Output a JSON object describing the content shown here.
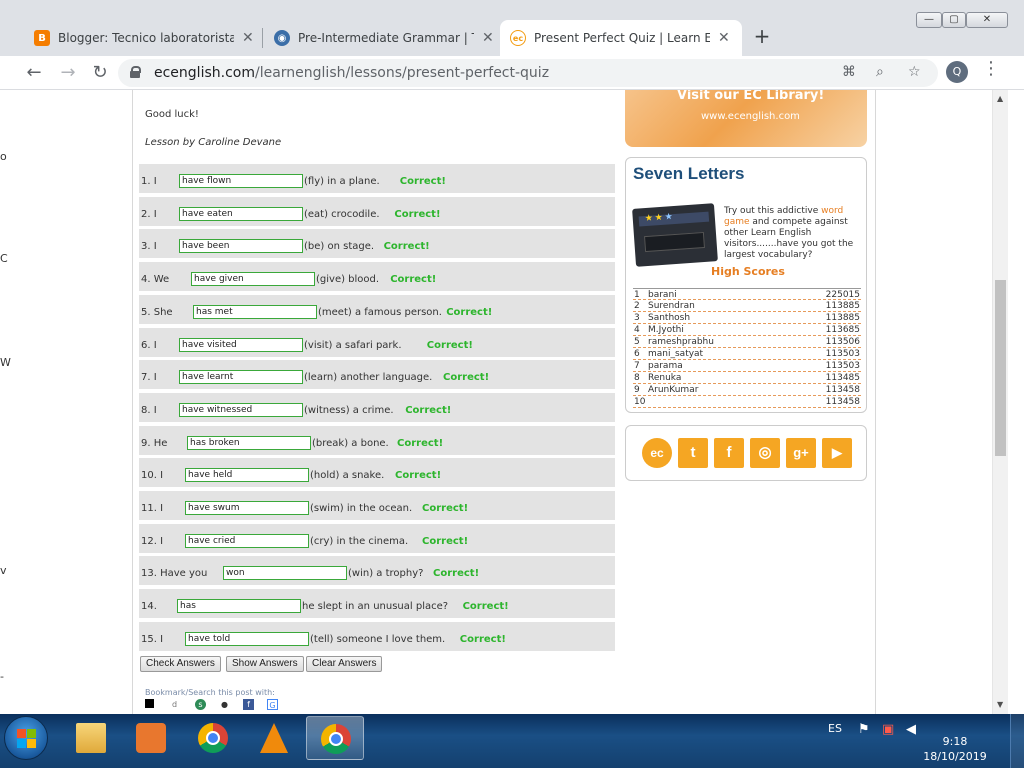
{
  "browser": {
    "tabs": [
      {
        "title": "Blogger: Tecnico laboratorista qu",
        "icon": "blogger-icon",
        "color": "#f57d00"
      },
      {
        "title": "Pre-Intermediate Grammar | The",
        "icon": "globe-icon",
        "color": "#3b6ea8"
      },
      {
        "title": "Present Perfect Quiz | Learn Engli",
        "icon": "ec-icon",
        "color": "#f39c12"
      }
    ],
    "close_glyph": "✕",
    "new_tab_glyph": "+",
    "url_host": "ecenglish.com",
    "url_path": "/learnenglish/lessons/present-perfect-quiz",
    "profile_initial": "Q",
    "menu_glyph": "⋮",
    "win_min": "—",
    "win_max": "▢",
    "win_close": "✕"
  },
  "page": {
    "left_edge_letters": [
      "o",
      "C",
      "W",
      "v",
      "-"
    ],
    "intro": {
      "good_luck": "Good luck!",
      "author": "Lesson by Caroline Devane"
    },
    "questions": [
      {
        "prefix": "1. I",
        "answer": "have flown",
        "suffix": "(fly) in a plane.",
        "result": "Correct!"
      },
      {
        "prefix": "2. I",
        "answer": "have eaten",
        "suffix": "(eat) crocodile.",
        "result": "Correct!"
      },
      {
        "prefix": "3. I",
        "answer": "have been",
        "suffix": "(be) on stage.",
        "result": "Correct!"
      },
      {
        "prefix": "4. We",
        "answer": "have given",
        "suffix": "(give) blood.",
        "result": "Correct!"
      },
      {
        "prefix": "5. She",
        "answer": "has met",
        "suffix": "(meet) a famous person.",
        "result": "Correct!"
      },
      {
        "prefix": "6. I",
        "answer": "have visited",
        "suffix": "(visit) a safari park.",
        "result": "Correct!"
      },
      {
        "prefix": "7. I",
        "answer": "have learnt",
        "suffix": "(learn) another language.",
        "result": "Correct!"
      },
      {
        "prefix": "8. I",
        "answer": "have witnessed",
        "suffix": "(witness) a crime.",
        "result": "Correct!"
      },
      {
        "prefix": "9. He",
        "answer": "has broken",
        "suffix": "(break) a bone.",
        "result": "Correct!"
      },
      {
        "prefix": "10. I",
        "answer": "have held",
        "suffix": "(hold) a snake.",
        "result": "Correct!"
      },
      {
        "prefix": "11. I",
        "answer": "have swum",
        "suffix": "(swim) in the ocean.",
        "result": "Correct!"
      },
      {
        "prefix": "12. I",
        "answer": "have cried",
        "suffix": "(cry) in the cinema.",
        "result": "Correct!"
      },
      {
        "prefix": "13. Have you",
        "answer": "won",
        "suffix": "(win) a trophy?",
        "result": "Correct!"
      },
      {
        "prefix": "14.",
        "answer": "has",
        "suffix": "he slept in an unusual place?",
        "result": "Correct!"
      },
      {
        "prefix": "15. I",
        "answer": "have told",
        "suffix": "(tell) someone I love them.",
        "result": "Correct!"
      }
    ],
    "buttons": {
      "check": "Check Answers",
      "show": "Show Answers",
      "clear": "Clear Answers"
    },
    "bookmark_label": "Bookmark/Search this post with:",
    "sidebar": {
      "banner_title": "Visit our EC Library!",
      "banner_url": "www.ecenglish.com",
      "seven_letters": {
        "title": "Seven Letters",
        "desc_pre": "Try out this addictive ",
        "desc_link": "word game",
        "desc_post": " and compete against other Learn English visitors.......have you got the largest vocabulary?",
        "high_scores_title": "High Scores",
        "scores": [
          {
            "rank": "1",
            "name": "barani",
            "score": "225015"
          },
          {
            "rank": "2",
            "name": "Surendran",
            "score": "113885"
          },
          {
            "rank": "3",
            "name": "Santhosh",
            "score": "113885"
          },
          {
            "rank": "4",
            "name": "M.Jyothi",
            "score": "113685"
          },
          {
            "rank": "5",
            "name": "rameshprabhu",
            "score": "113506"
          },
          {
            "rank": "6",
            "name": "mani_satyat",
            "score": "113503"
          },
          {
            "rank": "7",
            "name": "parama",
            "score": "113503"
          },
          {
            "rank": "8",
            "name": "Renuka",
            "score": "113485"
          },
          {
            "rank": "9",
            "name": "ArunKumar",
            "score": "113458"
          },
          {
            "rank": "10",
            "name": "",
            "score": "113458"
          }
        ]
      },
      "social": [
        {
          "name": "ec",
          "glyph": "ec"
        },
        {
          "name": "twitter",
          "glyph": "t"
        },
        {
          "name": "facebook",
          "glyph": "f"
        },
        {
          "name": "instagram",
          "glyph": "◎"
        },
        {
          "name": "google-plus",
          "glyph": "g+"
        },
        {
          "name": "youtube",
          "glyph": "▶"
        }
      ]
    }
  },
  "taskbar": {
    "language": "ES",
    "time": "9:18",
    "date": "18/10/2019"
  }
}
